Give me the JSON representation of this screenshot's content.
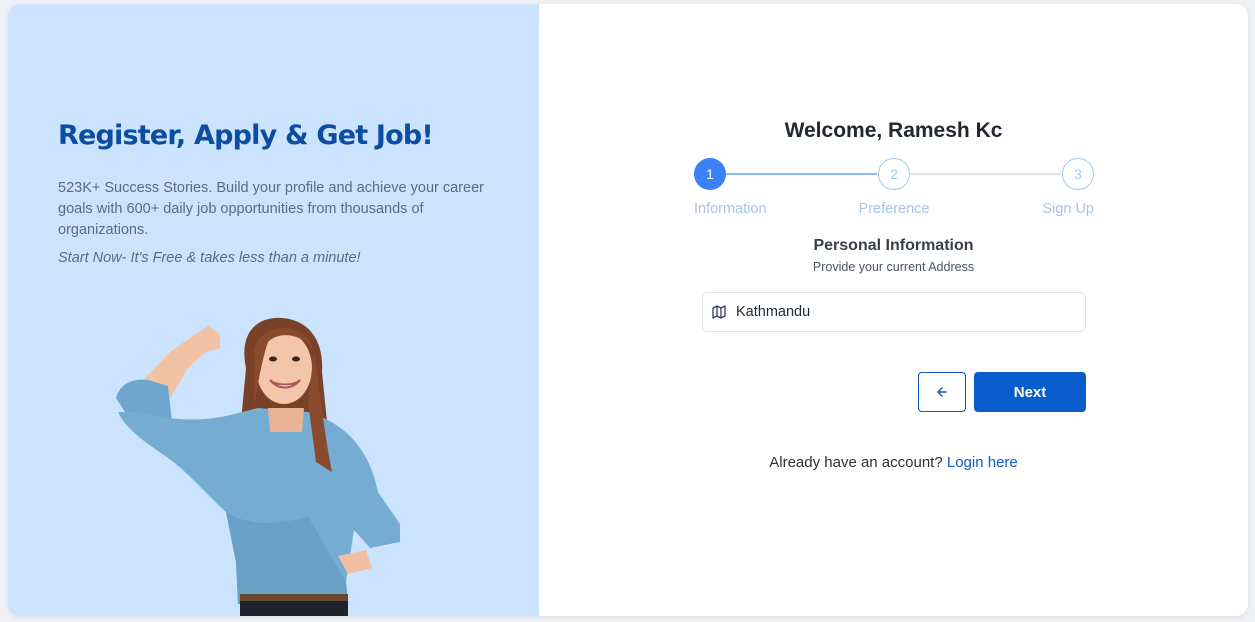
{
  "promo": {
    "headline": "Register, Apply & Get Job!",
    "description": "523K+ Success Stories. Build your profile and achieve your career goals with 600+ daily job opportunities from thousands of organizations.",
    "tagline": "Start Now- It's Free & takes less than a minute!"
  },
  "form": {
    "welcome": "Welcome, Ramesh Kc",
    "steps": [
      {
        "number": "1",
        "label": "Information",
        "state": "active"
      },
      {
        "number": "2",
        "label": "Preference",
        "state": "inactive"
      },
      {
        "number": "3",
        "label": "Sign Up",
        "state": "inactive"
      }
    ],
    "section_title": "Personal Information",
    "section_subtitle": "Provide your current Address",
    "address": {
      "value": "Kathmandu",
      "icon": "map-icon"
    },
    "back_icon": "arrow-left-icon",
    "next_label": "Next",
    "login_prompt": "Already have an account?",
    "login_link": "Login here"
  },
  "colors": {
    "brand_blue": "#0b5ccc",
    "headline_blue": "#0b4da2",
    "panel_bg": "#cce3fd",
    "step_active": "#3b82f6"
  }
}
